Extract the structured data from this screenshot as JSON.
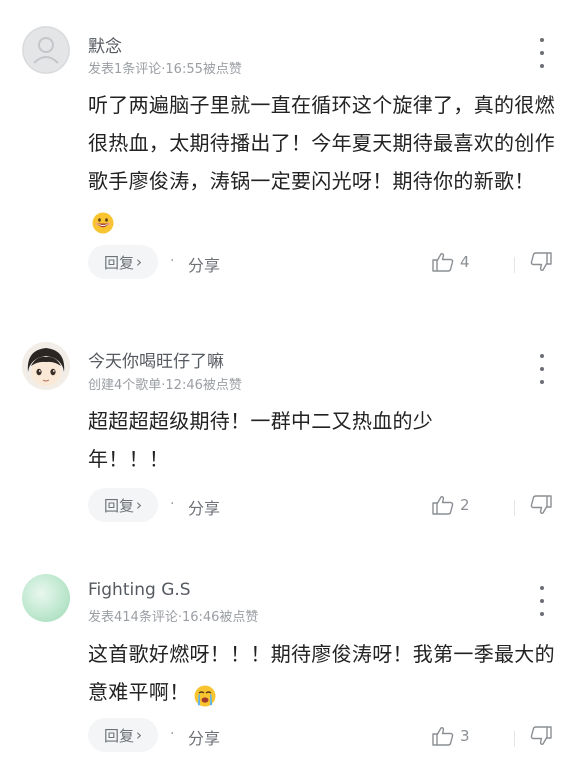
{
  "comments": [
    {
      "username": "默念",
      "meta": "发表1条评论·16:55被点赞",
      "body": "听了两遍脑子里就一直在循环这个旋律了，真的很燃很热血，太期待播出了！今年夏天期待最喜欢的创作歌手廖俊涛，涛锅一定要闪光呀！期待你的新歌！",
      "emoji": "grinning-face-emoji",
      "reply_label": "回复",
      "share_label": "分享",
      "like_count": "4"
    },
    {
      "username": "今天你喝旺仔了嘛",
      "meta": "创建4个歌单·12:46被点赞",
      "body": "超超超超级期待！一群中二又热血的少年！！！",
      "reply_label": "回复",
      "share_label": "分享",
      "like_count": "2"
    },
    {
      "username": "Fighting G.S",
      "meta": "发表414条评论·16:46被点赞",
      "body": "这首歌好燃呀！！！期待廖俊涛呀！我第一季最大的意难平啊！",
      "emoji": "crying-face-emoji",
      "reply_label": "回复",
      "share_label": "分享",
      "like_count": "3"
    }
  ]
}
